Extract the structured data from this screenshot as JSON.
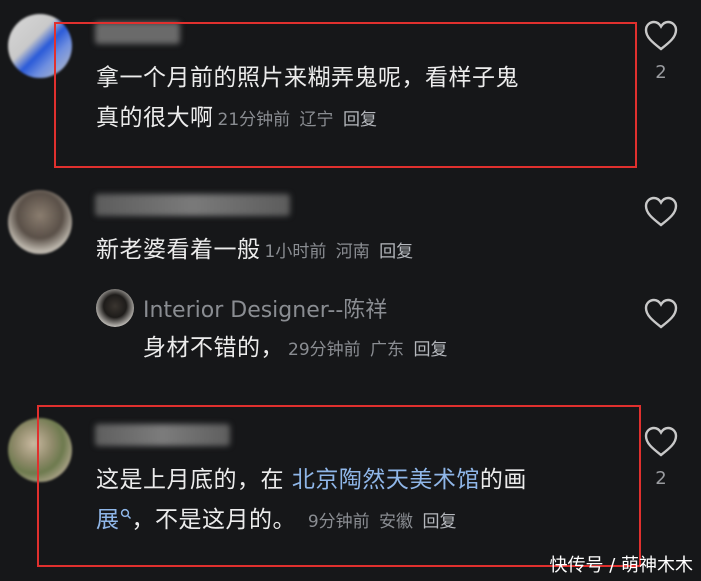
{
  "comments": [
    {
      "text": "拿一个月前的照片来糊弄鬼呢，看样子鬼真的很大啊",
      "text_line1": "拿一个月前的照片来糊弄鬼呢，看样子鬼",
      "text_line2": "真的很大啊",
      "time": "21分钟前",
      "location": "辽宁",
      "reply_label": "回复",
      "likes": "2"
    },
    {
      "text": "新老婆看着一般",
      "time": "1小时前",
      "location": "河南",
      "reply_label": "回复",
      "likes": ""
    },
    {
      "username": "Interior Designer--陈祥",
      "text": "身材不错的，",
      "time": "29分钟前",
      "location": "广东",
      "reply_label": "回复",
      "likes": ""
    },
    {
      "text_line1_a": "这是上月底的，在 ",
      "text_line1_link": "北京陶然天美术馆",
      "text_line1_b": "的画",
      "text_line2_a": "展",
      "text_line2_b": "，不是这月的。",
      "time": "9分钟前",
      "location": "安徽",
      "reply_label": "回复",
      "likes": "2"
    }
  ],
  "watermark": "快传号 / 萌神木木",
  "colors": {
    "background": "#161719",
    "highlight_box": "#e0302e",
    "link": "#8fb6e8"
  },
  "icons": [
    "heart-outline-icon",
    "search-icon"
  ]
}
